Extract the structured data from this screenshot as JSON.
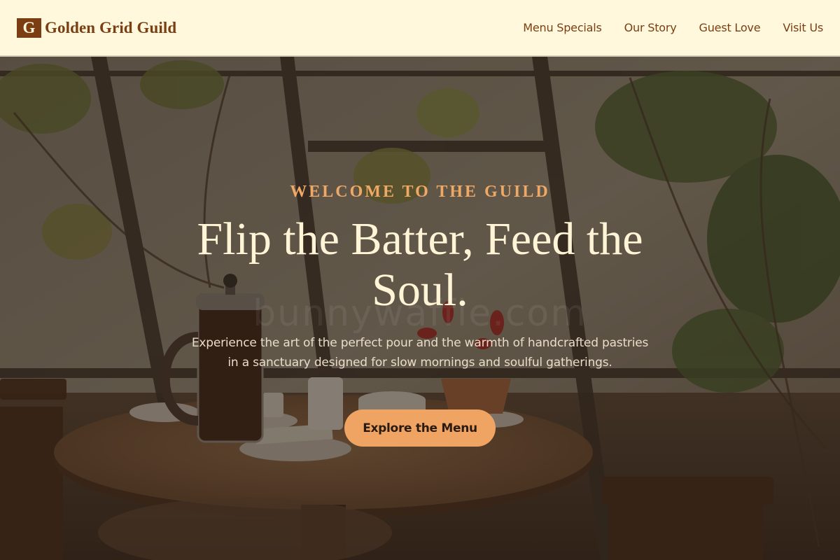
{
  "brand": {
    "mark": "G",
    "name": "Golden Grid Guild"
  },
  "nav": {
    "items": [
      {
        "label": "Menu Specials"
      },
      {
        "label": "Our Story"
      },
      {
        "label": "Guest Love"
      },
      {
        "label": "Visit Us"
      }
    ]
  },
  "hero": {
    "eyebrow": "WELCOME TO THE GUILD",
    "title": "Flip the Batter, Feed the Soul.",
    "subtitle": "Experience the art of the perfect pour and the warmth of handcrafted pastries in a sanctuary designed for slow mornings and soulful gatherings.",
    "cta_label": "Explore the Menu",
    "watermark": "bunnywaffle.com"
  },
  "colors": {
    "header_bg": "#fff8dc",
    "brand_brown": "#7a3e12",
    "accent_orange": "#f0a464",
    "hero_text": "#fff4d6"
  }
}
